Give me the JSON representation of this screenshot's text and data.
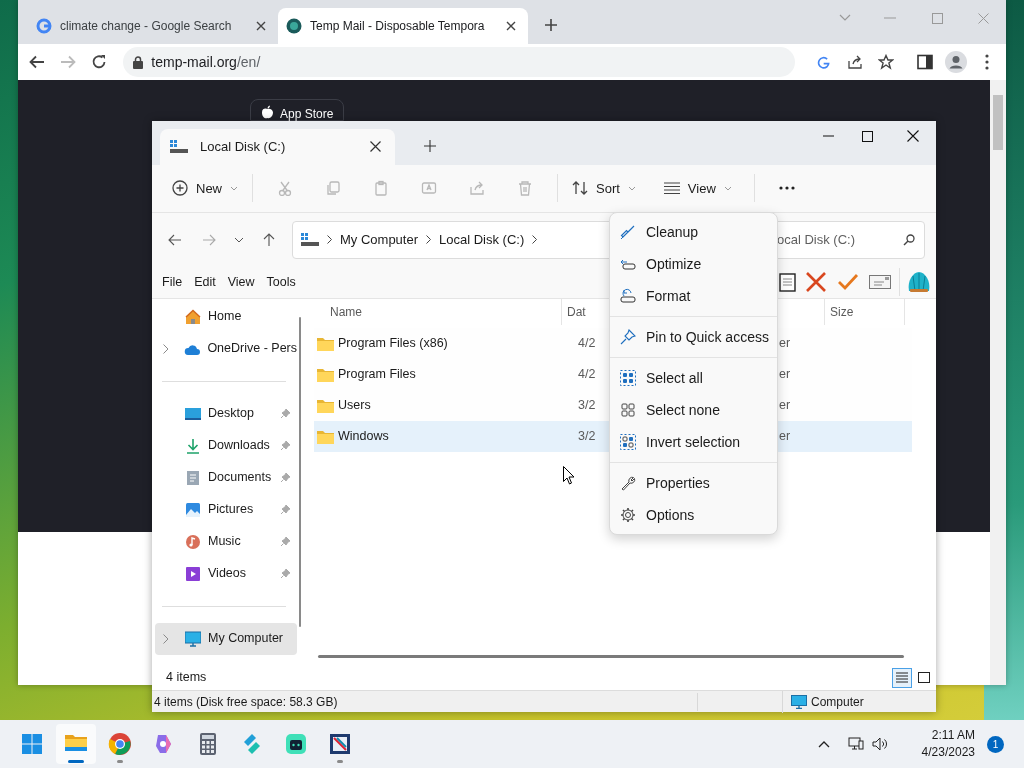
{
  "browser": {
    "tabs": [
      {
        "title": "climate change - Google Search",
        "selected": false
      },
      {
        "title": "Temp Mail - Disposable Tempora",
        "selected": true
      }
    ],
    "url_host": "temp-mail.org",
    "url_path": "/en/",
    "page_button": "App Store"
  },
  "explorer": {
    "tab_title": "Local Disk (C:)",
    "new_label": "New",
    "icon_tools_disabled": true,
    "sort_label": "Sort",
    "view_label": "View",
    "breadcrumb": [
      "My Computer",
      "Local Disk (C:)"
    ],
    "search_placeholder": "ocal Disk (C:)",
    "menu_bar": [
      "File",
      "Edit",
      "View",
      "Tools"
    ],
    "sidebar": [
      [
        {
          "label": "Home",
          "expandable": false,
          "pinned": false,
          "selected": false
        },
        {
          "label": "OneDrive - Pers",
          "expandable": true,
          "pinned": false,
          "selected": false
        }
      ],
      [
        {
          "label": "Desktop",
          "expandable": false,
          "pinned": true,
          "selected": false
        },
        {
          "label": "Downloads",
          "expandable": false,
          "pinned": true,
          "selected": false
        },
        {
          "label": "Documents",
          "expandable": false,
          "pinned": true,
          "selected": false
        },
        {
          "label": "Pictures",
          "expandable": false,
          "pinned": true,
          "selected": false
        },
        {
          "label": "Music",
          "expandable": false,
          "pinned": true,
          "selected": false
        },
        {
          "label": "Videos",
          "expandable": false,
          "pinned": true,
          "selected": false
        }
      ],
      [
        {
          "label": "My Computer",
          "expandable": true,
          "pinned": false,
          "selected": true
        }
      ]
    ],
    "columns": {
      "name": "Name",
      "date": "Dat",
      "size": "Size"
    },
    "rows": [
      {
        "name": "Program Files (x86)",
        "date": "4/2",
        "type": "er",
        "selected": false
      },
      {
        "name": "Program Files",
        "date": "4/2",
        "type": "er",
        "selected": false
      },
      {
        "name": "Users",
        "date": "3/2",
        "type": "er",
        "selected": false
      },
      {
        "name": "Windows",
        "date": "3/2",
        "type": "er",
        "selected": true
      }
    ],
    "item_count": "4 items",
    "view_buttons": [
      {
        "selected": true
      },
      {
        "selected": false
      }
    ],
    "status_bar": {
      "text": "4 items (Disk free space: 58.3 GB)",
      "location": "Computer"
    }
  },
  "context_menu": [
    [
      {
        "label": "Cleanup"
      },
      {
        "label": "Optimize"
      },
      {
        "label": "Format"
      }
    ],
    [
      {
        "label": "Pin to Quick access"
      }
    ],
    [
      {
        "label": "Select all"
      },
      {
        "label": "Select none"
      },
      {
        "label": "Invert selection"
      }
    ],
    [
      {
        "label": "Properties"
      },
      {
        "label": "Options"
      }
    ]
  ],
  "taskbar": {
    "apps": [
      {
        "active": true,
        "running": true
      },
      {
        "active": false,
        "running": true
      },
      {
        "active": false,
        "running": false
      },
      {
        "active": false,
        "running": false
      },
      {
        "active": false,
        "running": false
      },
      {
        "active": false,
        "running": false
      },
      {
        "active": false,
        "running": true
      }
    ],
    "time": "2:11 AM",
    "date": "4/23/2023",
    "notifications": "1"
  }
}
